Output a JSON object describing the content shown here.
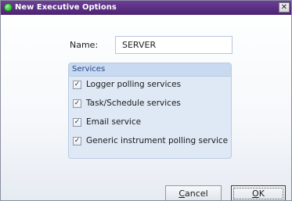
{
  "window": {
    "title": "New Executive Options",
    "close_glyph": "✕",
    "icon": "green-dot-icon"
  },
  "form": {
    "name_label": "Name:",
    "name_value": "SERVER"
  },
  "services": {
    "title": "Services",
    "items": [
      {
        "label": "Logger polling services",
        "checked": true
      },
      {
        "label": "Task/Schedule services",
        "checked": true
      },
      {
        "label": "Email service",
        "checked": true
      },
      {
        "label": "Generic instrument polling service",
        "checked": true
      }
    ]
  },
  "buttons": {
    "cancel_accel": "C",
    "cancel_rest": "ancel",
    "ok_accel": "O",
    "ok_rest": "K"
  },
  "colors": {
    "titlebar": "#5a2f82",
    "group_background": "#dfe8f5",
    "group_title": "#23478f"
  }
}
